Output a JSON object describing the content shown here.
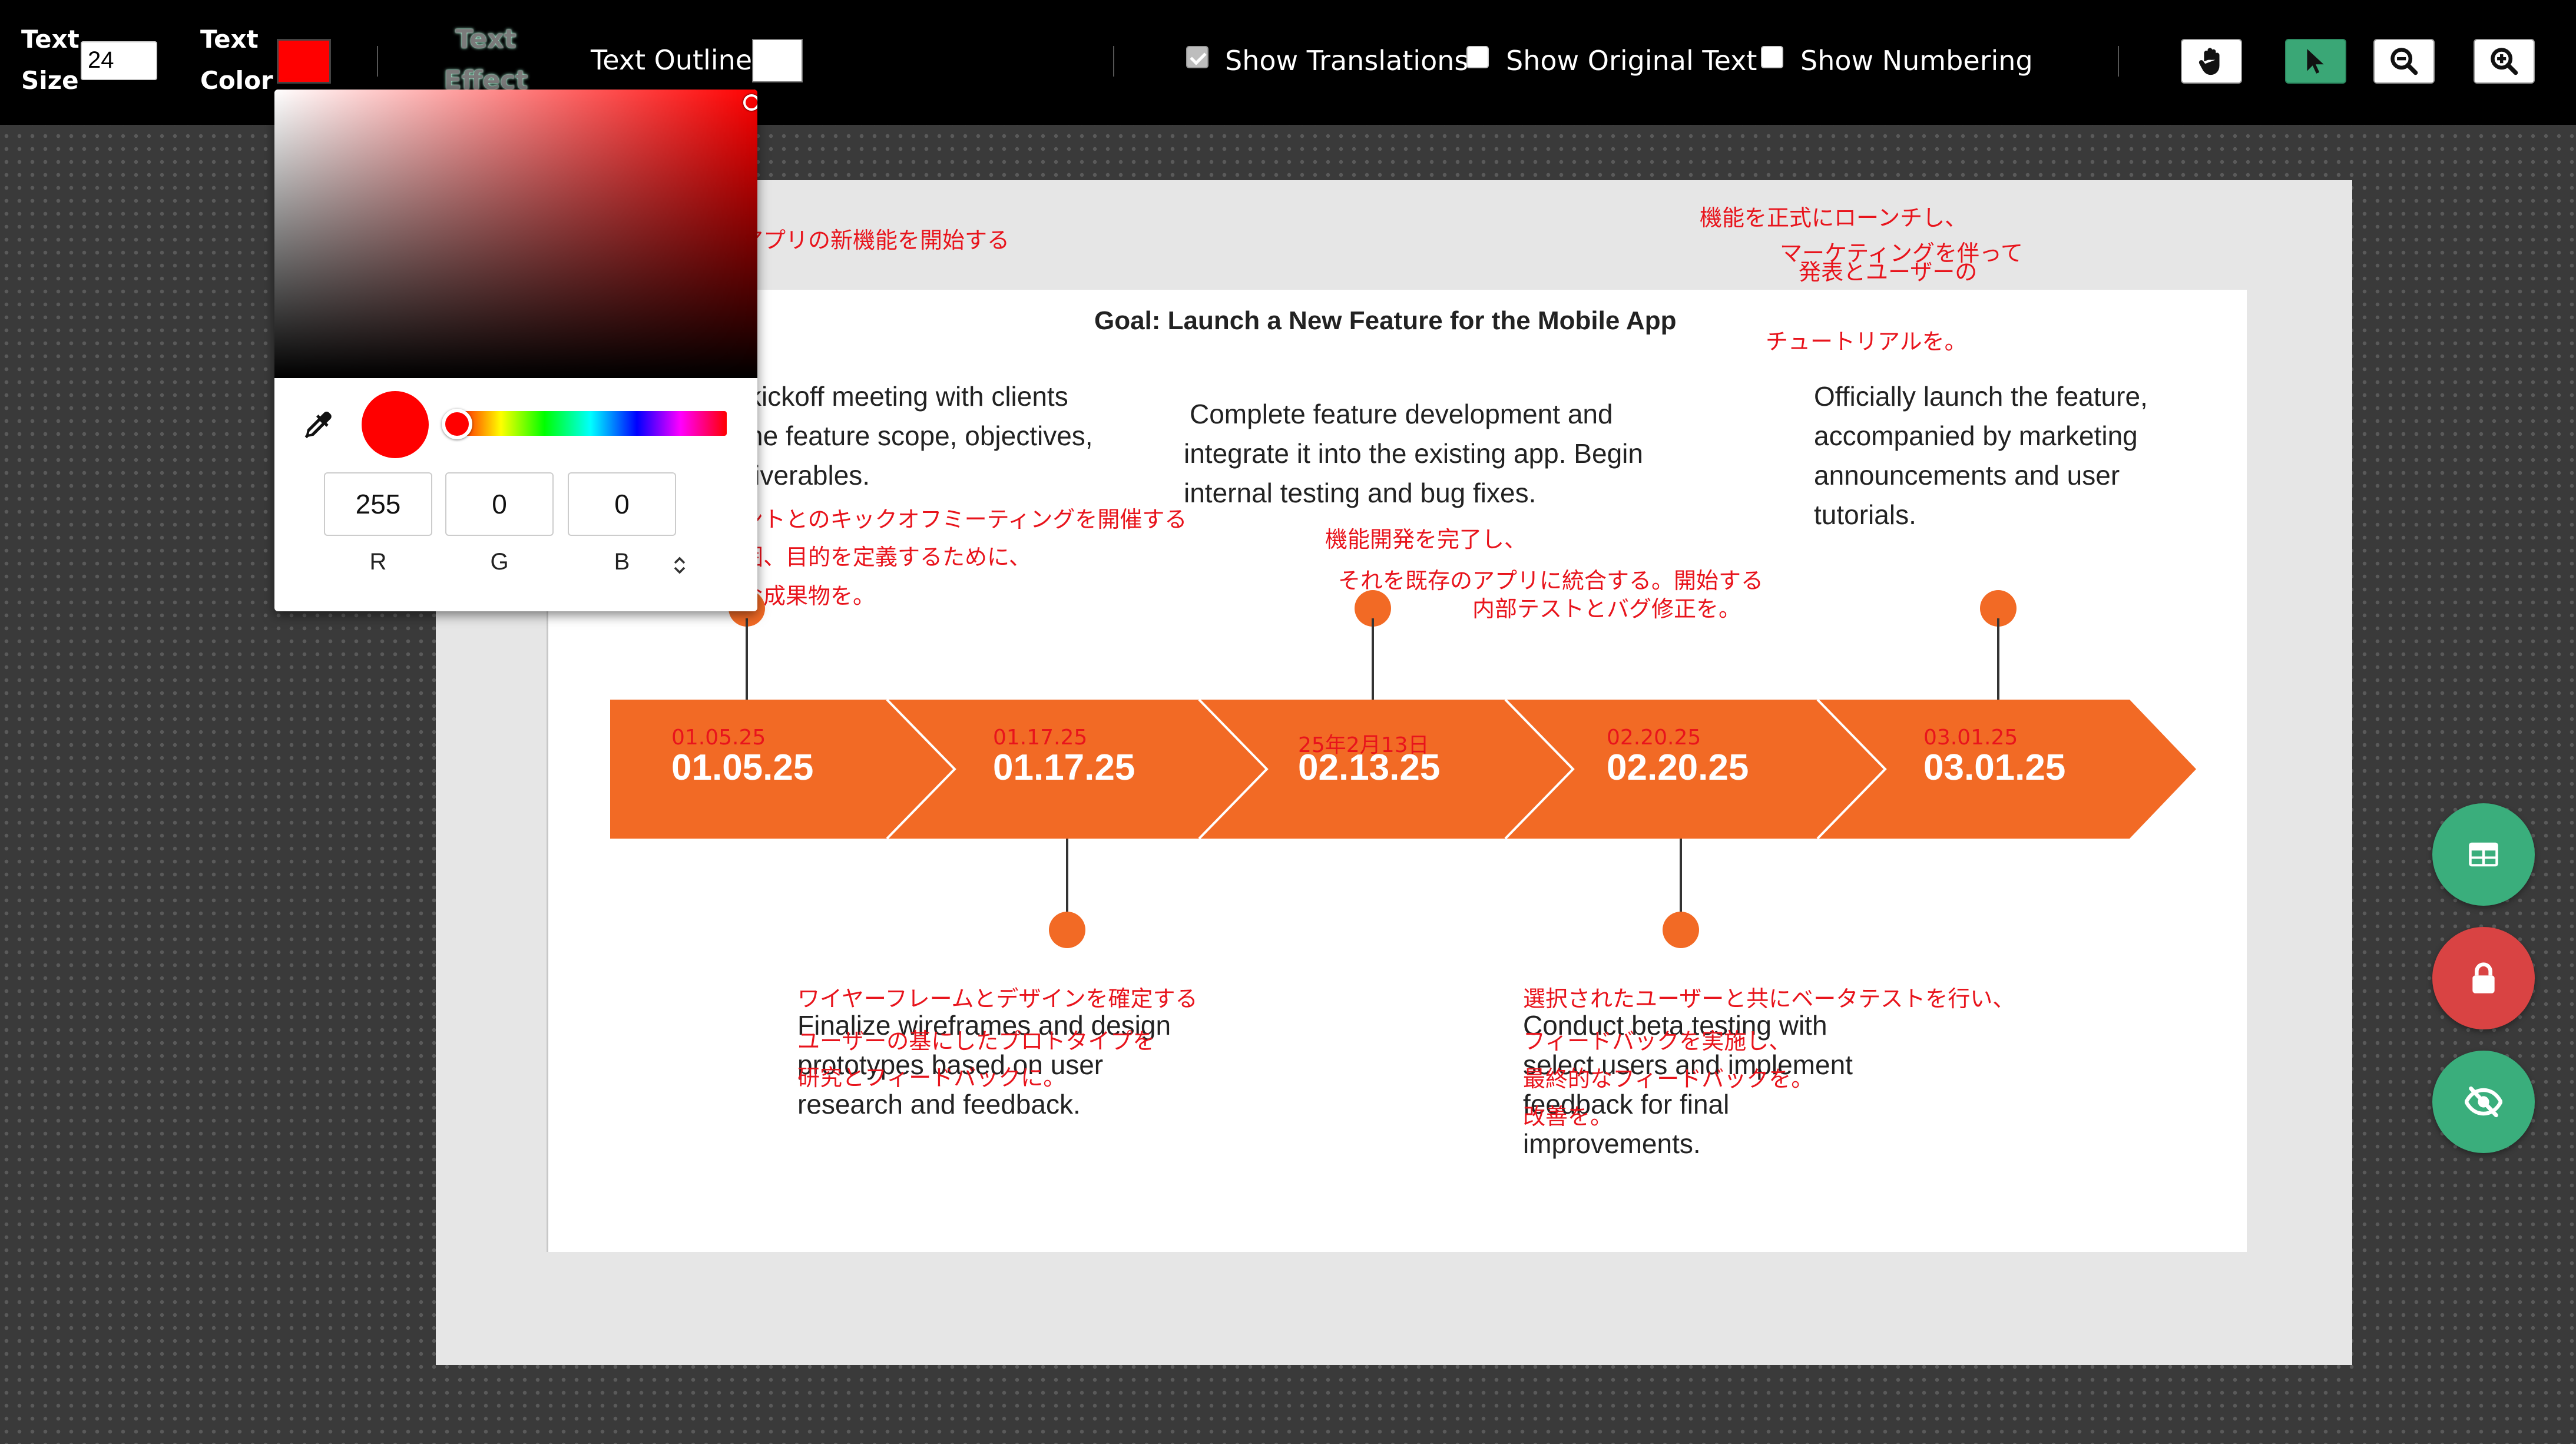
{
  "toolbar": {
    "text_size_label_1": "Text",
    "text_size_label_2": "Size",
    "text_size_value": "24",
    "text_color_label_1": "Text",
    "text_color_label_2": "Color",
    "text_color_value": "#ff0000",
    "text_effect_label_1": "Text",
    "text_effect_label_2": "Effect",
    "text_outline_label": "Text Outline",
    "show_translations_label": "Show Translations",
    "show_translations_checked": true,
    "show_original_label": "Show Original Text",
    "show_original_checked": false,
    "show_numbering_label": "Show Numbering",
    "show_numbering_checked": false,
    "tools": [
      "hand-icon",
      "pointer-icon",
      "zoom-out-icon",
      "zoom-in-icon"
    ],
    "active_tool": "pointer-icon"
  },
  "color_picker": {
    "r": "255",
    "g": "0",
    "b": "0",
    "r_label": "R",
    "g_label": "G",
    "b_label": "B",
    "mode_toggle": "⌃⌄"
  },
  "document": {
    "title": "Goal: Launch a New Feature for the Mobile App",
    "header_translation_left": "アプリの新機能を開始する",
    "header_translation_right_1": "機能を正式にローンチし、",
    "header_translation_right_2": "マーケティングを伴って",
    "header_translation_right_3": "発表とユーザーの",
    "header_translation_right_4": "チュートリアルを。",
    "milestones_top": [
      {
        "text_1": "kickoff meeting with clients",
        "text_2": "he feature scope, objectives,",
        "text_3": "liverables.",
        "tr_1": "ントとのキックオフミーティングを開催する",
        "tr_2": "囲、目的を定義するために、",
        "tr_3": "な成果物を。"
      },
      {
        "text_1": "Complete feature development and",
        "text_2": "integrate it into the existing app. Begin",
        "text_3": "internal testing and bug fixes.",
        "tr_1": "機能開発を完了し、",
        "tr_2": "それを既存のアプリに統合する。開始する",
        "tr_3": "内部テストとバグ修正を。"
      },
      {
        "text_1": "Officially launch the feature,",
        "text_2": "accompanied by marketing",
        "text_3": "announcements and user",
        "text_4": "tutorials."
      }
    ],
    "milestones_bottom": [
      {
        "text_1": "Finalize wireframes and design",
        "text_2": "prototypes based on user",
        "text_3": "research and feedback.",
        "tr_1": "ワイヤーフレームとデザインを確定する",
        "tr_2": "ユーザーの基にしたプロトタイプを",
        "tr_3": "研究とフィードバックに。"
      },
      {
        "text_1": "Conduct beta testing with",
        "text_2": "select users and implement",
        "text_3": "feedback for final",
        "text_4": "improvements.",
        "tr_1": "選択されたユーザーと共にベータテストを行い、",
        "tr_2": "フィードバックを実施し、",
        "tr_3": "最終的なフィードバックを。",
        "tr_4": "改善を。"
      }
    ],
    "dates": [
      {
        "value": "01.05.25",
        "translation": "01.05.25"
      },
      {
        "value": "01.17.25",
        "translation": "01.17.25"
      },
      {
        "value": "02.13.25",
        "translation": "25年2月13日"
      },
      {
        "value": "02.20.25",
        "translation": "02.20.25"
      },
      {
        "value": "03.01.25",
        "translation": "03.01.25"
      }
    ],
    "accent_color": "#f26a25"
  },
  "fab": {
    "buttons": [
      "table-icon",
      "lock-icon",
      "eye-off-icon"
    ],
    "colors": [
      "#3aae7c",
      "#d94343",
      "#3aae7c"
    ]
  }
}
